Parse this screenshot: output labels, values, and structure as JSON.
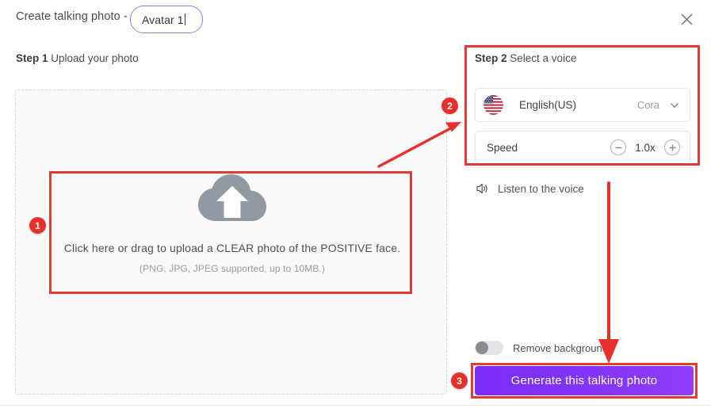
{
  "header": {
    "title": "Create talking photo -",
    "name_input_value": "Avatar 1",
    "name_input_placeholder": "Avatar 1",
    "close_label": "×"
  },
  "step1": {
    "step_number": "Step 1",
    "step_text": "Upload your photo",
    "upload": {
      "main_text": "Click here or drag to upload a CLEAR photo of the POSITIVE face.",
      "sub_text": "(PNG, JPG, JPEG supported, up to 10MB.)",
      "icon": "cloud-upload-icon"
    }
  },
  "step2": {
    "step_number": "Step 2",
    "step_text": "Select a voice",
    "voice": {
      "flag": "us-flag-icon",
      "language": "English(US)",
      "voice_name": "Cora",
      "chevron": "chevron-down-icon"
    },
    "speed": {
      "label": "Speed",
      "value": "1.0x",
      "decrease": "minus-circle-icon",
      "increase": "plus-circle-icon"
    },
    "listen": {
      "icon": "speaker-icon",
      "label": "Listen to the voice"
    }
  },
  "options": {
    "remove_background_label": "Remove background",
    "remove_background_on": false
  },
  "actions": {
    "generate_label": "Generate this talking photo"
  },
  "annotations": {
    "badge_1": "1",
    "badge_2": "2",
    "badge_3": "3",
    "highlight_color": "#e03b34",
    "badge_color": "#e8302b"
  },
  "theme": {
    "accent_purple": "#7b2ff7",
    "input_border": "#9b7ad6",
    "panel_bg": "#fafafa"
  }
}
